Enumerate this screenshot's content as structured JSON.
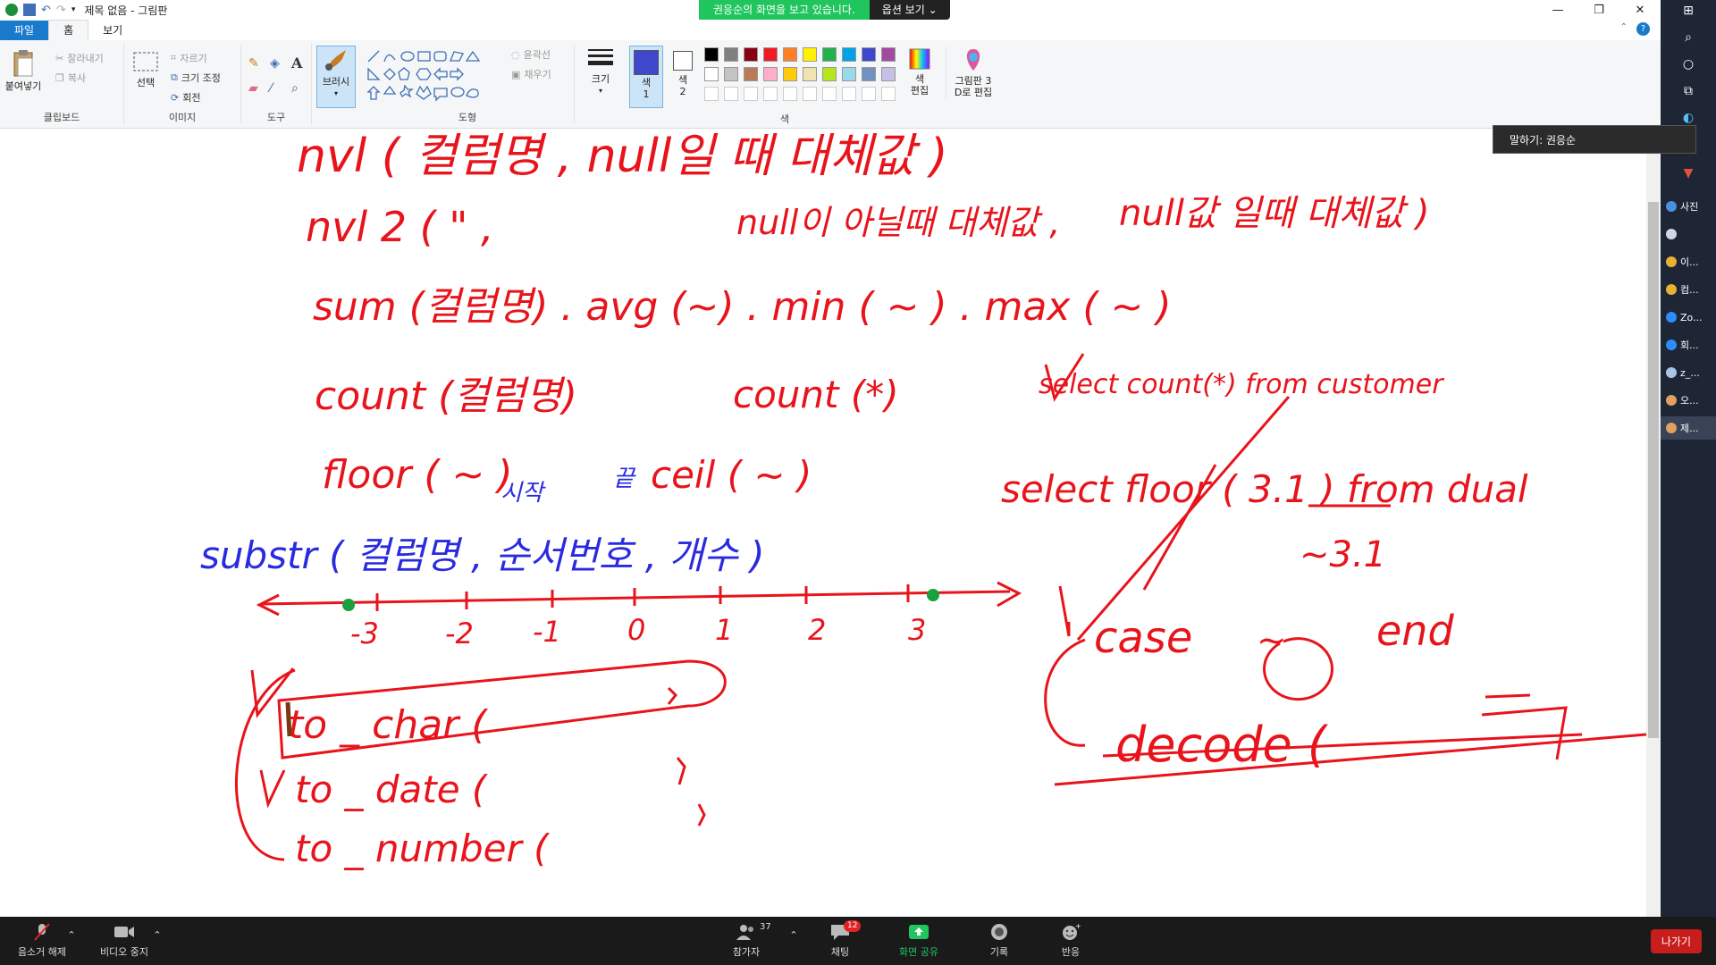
{
  "window": {
    "title": "제목 없음 - 그림판",
    "minimize": "—",
    "maximize": "❐",
    "close": "✕"
  },
  "share_banner": {
    "message": "권응순의 화면을 보고 있습니다.",
    "options": "옵션 보기 ⌄"
  },
  "tabs": [
    "파일",
    "홈",
    "보기"
  ],
  "ribbon": {
    "clipboard": {
      "paste": "붙여넣기",
      "cut": "잘라내기",
      "copy": "복사",
      "label": "클립보드"
    },
    "image": {
      "select": "선택",
      "crop": "자르기",
      "resize": "크기 조정",
      "rotate": "회전",
      "label": "이미지"
    },
    "tools": {
      "label": "도구",
      "brush": "브러시"
    },
    "shapes": {
      "outline": "윤곽선",
      "fill": "채우기",
      "label": "도형"
    },
    "size": "크기",
    "color1": "색\n1",
    "color2": "색\n2",
    "colors_label": "색",
    "edit_colors": "색\n편집",
    "paint3d": "그림판 3\nD로 편집",
    "palette": [
      "#000000",
      "#7f7f7f",
      "#880015",
      "#ed1c24",
      "#ff7f27",
      "#fff200",
      "#22b14c",
      "#00a2e8",
      "#3f48cc",
      "#a349a4",
      "#ffffff",
      "#c3c3c3",
      "#b97a57",
      "#ffaec9",
      "#ffc90e",
      "#efe4b0",
      "#b5e61d",
      "#99d9ea",
      "#7092be",
      "#c8bfe7"
    ],
    "color1_value": "#3f48cc",
    "color2_value": "#ffffff"
  },
  "tooltip": "말하기: 권응순",
  "taskbar_items": [
    {
      "label": "사진",
      "icon": "photos-icon"
    },
    {
      "label": "",
      "icon": "3d-viewer-icon"
    },
    {
      "label": "이...",
      "icon": "chrome-icon"
    },
    {
      "label": "컴...",
      "icon": "chrome-icon"
    },
    {
      "label": "Zo...",
      "icon": "zoom-icon"
    },
    {
      "label": "회...",
      "icon": "zoom-icon"
    },
    {
      "label": "z_...",
      "icon": "notepad-icon"
    },
    {
      "label": "오...",
      "icon": "paint-icon"
    },
    {
      "label": "제...",
      "icon": "paint-icon"
    }
  ],
  "zoom": {
    "mute": "음소거 해제",
    "video": "비디오 중지",
    "participants": "참가자",
    "participants_count": "37",
    "chat": "채팅",
    "chat_badge": "12",
    "share": "화면 공유",
    "record": "기록",
    "reactions": "반응",
    "leave": "나가기"
  },
  "handwriting": {
    "line1": "nvl ( 컬럼명 ,  null일 때 대체값 )",
    "line2a": "nvl 2 (  \"  ,",
    "line2b": "null이 아닐때 대체값 ,",
    "line2c": "null값 일때 대체값 )",
    "line3": "sum (컬럼명) . avg (~) . min ( ~ ) . max ( ~ )",
    "line4a": "count (컬럼명)",
    "line4b": "count (*)",
    "line4c": "select count(*) from customer",
    "line5a": "floor ( ~ )",
    "line5b": "ceil ( ~ )",
    "line5c": "select floor ( 3.1 ) from dual",
    "line5d": "~3.1",
    "blue_note1": "시작",
    "blue_note2": "끝",
    "line6": "substr ( 컬럼명 , 순서번호 , 개수 )",
    "axis_labels": [
      "-3",
      "-2",
      "-1",
      "0",
      "1",
      "2",
      "3"
    ],
    "conv1": "to _ char (",
    "conv2": "to _ date (",
    "conv3": "to _ number (",
    "case": "case",
    "case_mid": "~",
    "end": "end",
    "decode": "decode ("
  }
}
